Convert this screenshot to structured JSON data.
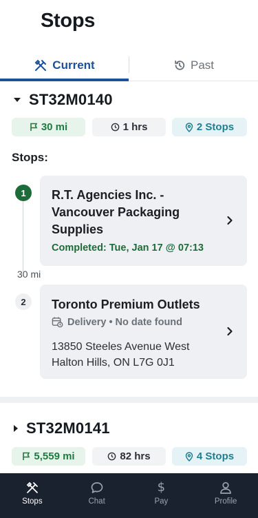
{
  "page": {
    "title": "Stops"
  },
  "tabs": [
    {
      "label": "Current",
      "icon": "crossed-tools-icon",
      "active": true
    },
    {
      "label": "Past",
      "icon": "history-icon",
      "active": false
    }
  ],
  "trips": [
    {
      "id": "ST32M0140",
      "expanded": true,
      "distance": "30 mi",
      "duration": "1 hrs",
      "stops_count": "2 Stops",
      "stops_heading": "Stops:",
      "stops": [
        {
          "number": "1",
          "name": "R.T. Agencies Inc. - Vancouver Packaging Supplies",
          "status": "Completed: Tue, Jan 17 @ 07:13",
          "completed": true
        },
        {
          "number": "2",
          "name": "Toronto Premium Outlets",
          "status": "Delivery • No date found",
          "address_line1": "13850 Steeles Avenue West",
          "address_line2": "Halton Hills, ON L7G 0J1",
          "completed": false
        }
      ],
      "segment_distance": "30 mi"
    },
    {
      "id": "ST32M0141",
      "expanded": false,
      "distance": "5,559 mi",
      "duration": "82 hrs",
      "stops_count": "4 Stops"
    }
  ],
  "bottom_nav": [
    {
      "label": "Stops",
      "icon": "crossed-tools-icon",
      "active": true
    },
    {
      "label": "Chat",
      "icon": "chat-bubble-icon",
      "active": false
    },
    {
      "label": "Pay",
      "icon": "dollar-icon",
      "active": false,
      "glyph": "$"
    },
    {
      "label": "Profile",
      "icon": "person-icon",
      "active": false
    }
  ],
  "colors": {
    "primary": "#1c4f9c",
    "completed_green": "#1e6b3a",
    "nav_bg": "#1a2230",
    "card_bg": "#eef0f3"
  }
}
